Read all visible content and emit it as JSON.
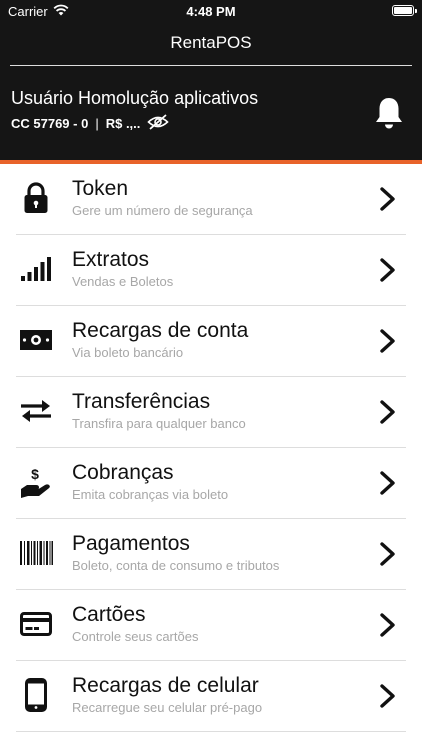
{
  "status_bar": {
    "carrier": "Carrier",
    "time": "4:48 PM"
  },
  "header": {
    "title": "RentaPOS",
    "user_name": "Usuário Homolução aplicativos",
    "account": "CC 57769 - 0",
    "separator": "|",
    "balance": "R$ .,..",
    "eye_icon": "eye-slash-icon",
    "bell_icon": "bell-icon"
  },
  "colors": {
    "header_bg": "#151515",
    "accent": "#e8632a",
    "subtitle": "#a7a7a7"
  },
  "menu": [
    {
      "title": "Token",
      "subtitle": "Gere um número de segurança",
      "icon": "lock-icon"
    },
    {
      "title": "Extratos",
      "subtitle": "Vendas e Boletos",
      "icon": "signal-bars-icon"
    },
    {
      "title": "Recargas de conta",
      "subtitle": "Via boleto bancário",
      "icon": "money-bill-icon"
    },
    {
      "title": "Transferências",
      "subtitle": "Transfira para qualquer banco",
      "icon": "exchange-arrows-icon"
    },
    {
      "title": "Cobranças",
      "subtitle": "Emita cobranças via boleto",
      "icon": "hand-dollar-icon"
    },
    {
      "title": "Pagamentos",
      "subtitle": "Boleto, conta de consumo e tributos",
      "icon": "barcode-icon"
    },
    {
      "title": "Cartões",
      "subtitle": "Controle seus cartões",
      "icon": "credit-card-icon"
    },
    {
      "title": "Recargas de celular",
      "subtitle": "Recarregue seu celular pré-pago",
      "icon": "mobile-phone-icon"
    }
  ]
}
